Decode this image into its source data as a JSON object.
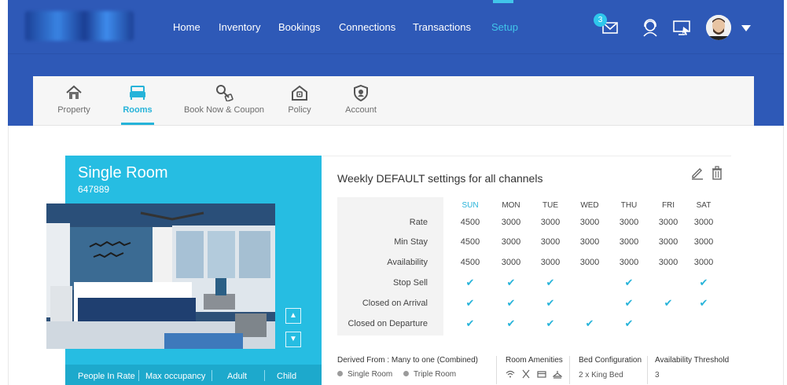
{
  "nav": {
    "items": [
      {
        "label": "Home",
        "active": false
      },
      {
        "label": "Inventory",
        "active": false
      },
      {
        "label": "Bookings",
        "active": false
      },
      {
        "label": "Connections",
        "active": false
      },
      {
        "label": "Transactions",
        "active": false
      },
      {
        "label": "Setup",
        "active": true
      }
    ],
    "mail_badge": "3",
    "icons": [
      "mail-icon",
      "support-headset-icon",
      "screen-share-icon"
    ]
  },
  "tabs": [
    {
      "label": "Property",
      "icon": "house-icon",
      "active": false
    },
    {
      "label": "Rooms",
      "icon": "bed-icon",
      "active": true
    },
    {
      "label": "Book Now & Coupon",
      "icon": "key-tag-icon",
      "active": false
    },
    {
      "label": "Policy",
      "icon": "policy-house-icon",
      "active": false
    },
    {
      "label": "Account",
      "icon": "shield-account-icon",
      "active": false
    }
  ],
  "room": {
    "title": "Single Room",
    "code": "647889",
    "footer": [
      "People In Rate",
      "Max occupancy",
      "Adult",
      "Child"
    ]
  },
  "weekly": {
    "title": "Weekly DEFAULT settings for all channels",
    "days": [
      "SUN",
      "MON",
      "TUE",
      "WED",
      "THU",
      "FRI",
      "SAT"
    ],
    "rows": [
      {
        "label": "Rate",
        "values": [
          "4500",
          "3000",
          "3000",
          "3000",
          "3000",
          "3000",
          "3000"
        ]
      },
      {
        "label": "Min Stay",
        "values": [
          "4500",
          "3000",
          "3000",
          "3000",
          "3000",
          "3000",
          "3000"
        ]
      },
      {
        "label": "Availability",
        "values": [
          "4500",
          "3000",
          "3000",
          "3000",
          "3000",
          "3000",
          "3000"
        ]
      }
    ],
    "check_rows": [
      {
        "label": "Stop Sell",
        "checks": [
          true,
          true,
          true,
          false,
          true,
          false,
          true
        ]
      },
      {
        "label": "Closed on Arrival",
        "checks": [
          true,
          true,
          true,
          false,
          true,
          true,
          true
        ]
      },
      {
        "label": "Closed on Departure",
        "checks": [
          true,
          true,
          true,
          true,
          true,
          false,
          false
        ]
      }
    ]
  },
  "details": {
    "derived_label": "Derived From :",
    "derived_value": "Many to one (Combined)",
    "derived_rooms": [
      "Single Room",
      "Triple Room"
    ],
    "amenities_label": "Room Amenities",
    "amenity_icons": [
      "wifi-icon",
      "restaurant-icon",
      "card-icon",
      "hanger-icon"
    ],
    "bed_label": "Bed Configuration",
    "bed_value": "2 x King Bed",
    "threshold_label": "Availability Threshold",
    "threshold_value": "3"
  }
}
